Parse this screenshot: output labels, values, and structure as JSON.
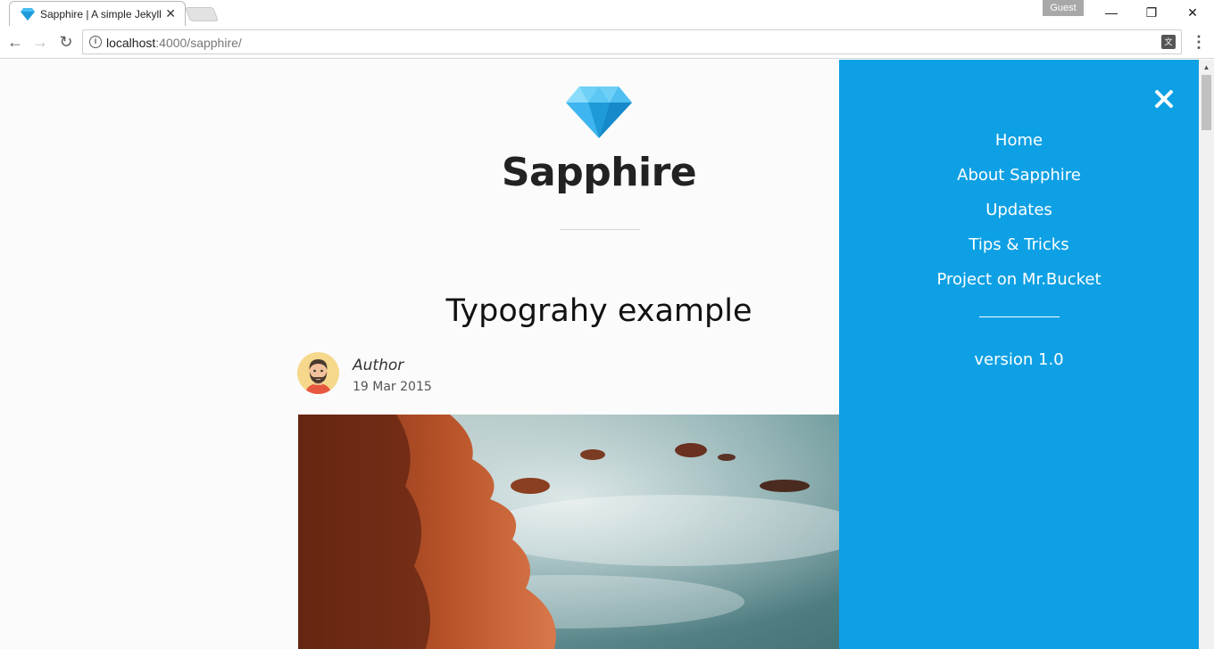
{
  "browser": {
    "tab_title": "Sapphire | A simple Jekyll",
    "tab_close": "✕",
    "profile_label": "Guest",
    "minimize_glyph": "—",
    "restore_glyph": "❐",
    "close_glyph": "✕",
    "back_glyph": "←",
    "forward_glyph": "→",
    "reload_glyph": "↻",
    "url_host": "localhost",
    "url_rest": ":4000/sapphire/",
    "info_glyph": "i",
    "translate_glyph": "文",
    "menu_glyph": "⋮"
  },
  "page": {
    "logo_icon": "diamond-icon",
    "site_title": "Sapphire",
    "post_title": "Typograhy example",
    "author_name": "Author",
    "author_date": "19 Mar 2015",
    "hero_image": "rocky-coast-misty-sea"
  },
  "sidebar": {
    "close_icon": "close-icon",
    "items": [
      {
        "label": "Home"
      },
      {
        "label": "About Sapphire"
      },
      {
        "label": "Updates"
      },
      {
        "label": "Tips & Tricks"
      },
      {
        "label": "Project on Mr.Bucket"
      }
    ],
    "version": "version 1.0",
    "background_color": "#0ea0e4"
  },
  "colors": {
    "accent": "#0ea0e4",
    "diamond_light": "#6fd0f7",
    "diamond_dark": "#1e9ad8"
  }
}
